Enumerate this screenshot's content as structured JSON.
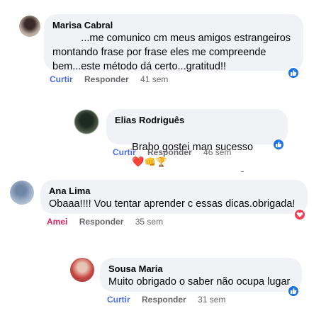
{
  "comments": [
    {
      "author": "Marisa Cabral",
      "text": "          ...me comunico cm meus amigos estrangeiros\nmontando frase por frase eles me compreende\nbem...este método dá certo...gratitud!!",
      "actions": {
        "react": "Curtir",
        "reply": "Responder",
        "time": "41 sem"
      },
      "reaction": "like-icon"
    },
    {
      "author": "Elias Rodriguês",
      "text": "Brabo gostei man sucesso",
      "emojis": [
        "❤️",
        "👊",
        "🏆"
      ],
      "actions": {
        "react": "Curtir",
        "reply": "Responder",
        "time": "46 sem"
      },
      "reaction": "like-icon"
    },
    {
      "author": "Ana Lima",
      "text": "Obaaa!!!! Vou tentar aprender c essas dicas.obrigada!",
      "actions": {
        "react": "Amei",
        "reply": "Responder",
        "time": "35 sem"
      },
      "reaction": "love-icon"
    },
    {
      "author": "Sousa Maria",
      "text": "Muito obrigado o saber não ocupa lugar",
      "actions": {
        "react": "Curtir",
        "reply": "Responder",
        "time": "31 sem"
      },
      "reaction": "like-icon"
    }
  ],
  "colors": {
    "bubble": "#f0f2f5",
    "like_blue": "#1b74e4",
    "like_text": "#4a6ee0",
    "love_red": "#e0245e",
    "muted": "#65676b"
  }
}
